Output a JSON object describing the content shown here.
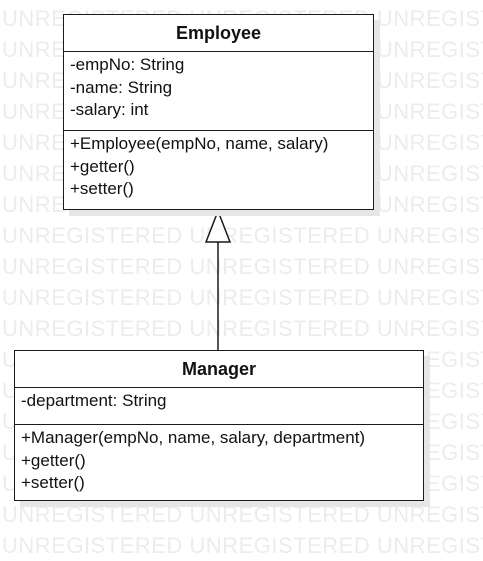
{
  "watermark_text": "UNREGISTERED",
  "classes": {
    "employee": {
      "name": "Employee",
      "attributes": [
        "-empNo: String",
        "-name: String",
        "-salary: int"
      ],
      "operations": [
        "+Employee(empNo, name, salary)",
        "+getter()",
        "+setter()"
      ]
    },
    "manager": {
      "name": "Manager",
      "attributes": [
        "-department: String"
      ],
      "operations": [
        "+Manager(empNo, name, salary, department)",
        "+getter()",
        "+setter()"
      ]
    }
  },
  "relations": [
    {
      "type": "generalization",
      "from": "Manager",
      "to": "Employee"
    }
  ]
}
